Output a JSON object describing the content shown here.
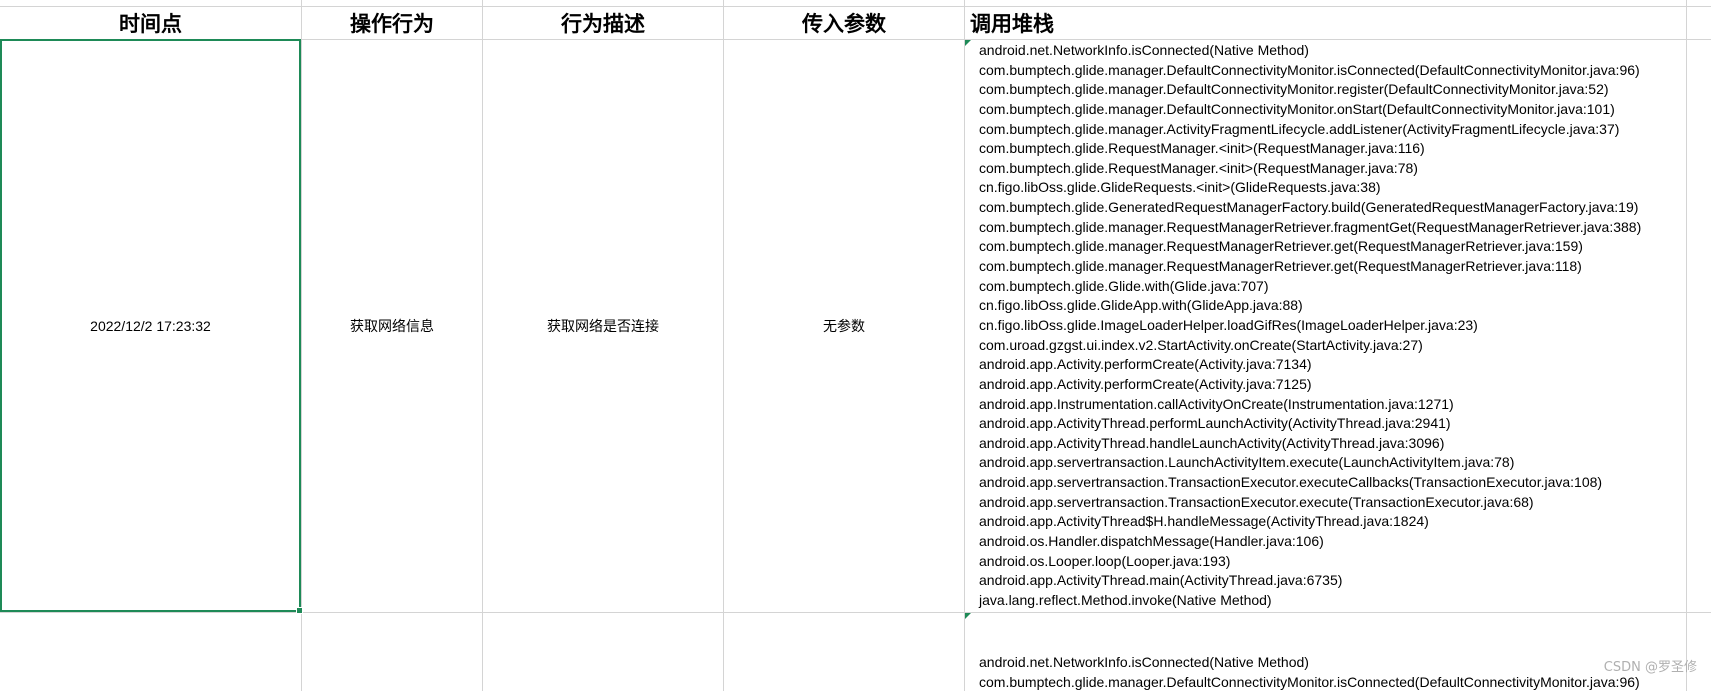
{
  "headers": {
    "time": "时间点",
    "action": "操作行为",
    "description": "行为描述",
    "params": "传入参数",
    "stack": "调用堆栈"
  },
  "rows": [
    {
      "time": "2022/12/2 17:23:32",
      "action": "获取网络信息",
      "description": "获取网络是否连接",
      "params": "无参数",
      "stack": [
        "android.net.NetworkInfo.isConnected(Native Method)",
        "com.bumptech.glide.manager.DefaultConnectivityMonitor.isConnected(DefaultConnectivityMonitor.java:96)",
        "com.bumptech.glide.manager.DefaultConnectivityMonitor.register(DefaultConnectivityMonitor.java:52)",
        "com.bumptech.glide.manager.DefaultConnectivityMonitor.onStart(DefaultConnectivityMonitor.java:101)",
        "com.bumptech.glide.manager.ActivityFragmentLifecycle.addListener(ActivityFragmentLifecycle.java:37)",
        "com.bumptech.glide.RequestManager.<init>(RequestManager.java:116)",
        "com.bumptech.glide.RequestManager.<init>(RequestManager.java:78)",
        "cn.figo.libOss.glide.GlideRequests.<init>(GlideRequests.java:38)",
        "com.bumptech.glide.GeneratedRequestManagerFactory.build(GeneratedRequestManagerFactory.java:19)",
        "com.bumptech.glide.manager.RequestManagerRetriever.fragmentGet(RequestManagerRetriever.java:388)",
        "com.bumptech.glide.manager.RequestManagerRetriever.get(RequestManagerRetriever.java:159)",
        "com.bumptech.glide.manager.RequestManagerRetriever.get(RequestManagerRetriever.java:118)",
        "com.bumptech.glide.Glide.with(Glide.java:707)",
        "cn.figo.libOss.glide.GlideApp.with(GlideApp.java:88)",
        "cn.figo.libOss.glide.ImageLoaderHelper.loadGifRes(ImageLoaderHelper.java:23)",
        "com.uroad.gzgst.ui.index.v2.StartActivity.onCreate(StartActivity.java:27)",
        "android.app.Activity.performCreate(Activity.java:7134)",
        "android.app.Activity.performCreate(Activity.java:7125)",
        "android.app.Instrumentation.callActivityOnCreate(Instrumentation.java:1271)",
        "android.app.ActivityThread.performLaunchActivity(ActivityThread.java:2941)",
        "android.app.ActivityThread.handleLaunchActivity(ActivityThread.java:3096)",
        "android.app.servertransaction.LaunchActivityItem.execute(LaunchActivityItem.java:78)",
        "android.app.servertransaction.TransactionExecutor.executeCallbacks(TransactionExecutor.java:108)",
        "android.app.servertransaction.TransactionExecutor.execute(TransactionExecutor.java:68)",
        "android.app.ActivityThread$H.handleMessage(ActivityThread.java:1824)",
        "android.os.Handler.dispatchMessage(Handler.java:106)",
        "android.os.Looper.loop(Looper.java:193)",
        "android.app.ActivityThread.main(ActivityThread.java:6735)",
        "java.lang.reflect.Method.invoke(Native Method)"
      ]
    },
    {
      "stack": [
        "android.net.NetworkInfo.isConnected(Native Method)",
        "com.bumptech.glide.manager.DefaultConnectivityMonitor.isConnected(DefaultConnectivityMonitor.java:96)"
      ]
    }
  ],
  "watermark": "CSDN @罗圣修",
  "colors": {
    "selection": "#1e8a57",
    "gridline": "#d4d4d4"
  }
}
